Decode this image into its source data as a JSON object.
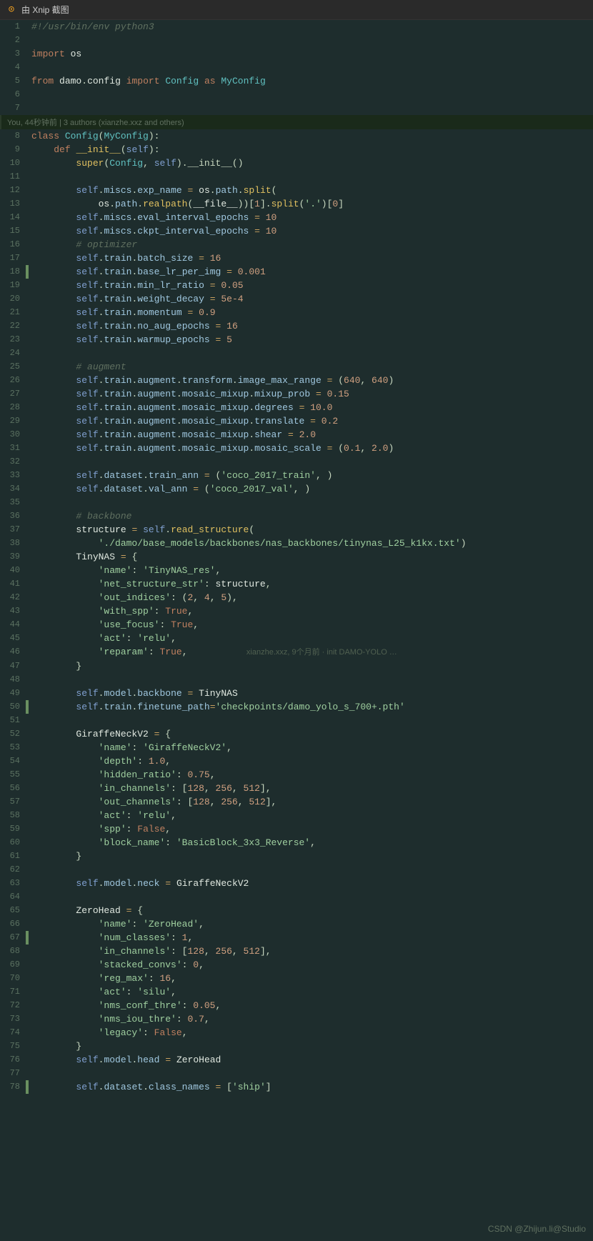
{
  "title": "由 Xnip 截图",
  "watermark": "CSDN @Zhijun.li@Studio",
  "git_blame": "You, 44秒钟前 | 3 authors (xianzhe.xxz and others)",
  "lines": [
    {
      "num": 1,
      "content": "#!/usr/bin/env python3",
      "indicator": false
    },
    {
      "num": 2,
      "content": "",
      "indicator": false
    },
    {
      "num": 3,
      "content": "import os",
      "indicator": false
    },
    {
      "num": 4,
      "content": "",
      "indicator": false
    },
    {
      "num": 5,
      "content": "from damo.config import Config as MyConfig",
      "indicator": false
    },
    {
      "num": 6,
      "content": "",
      "indicator": false
    },
    {
      "num": 7,
      "content": "",
      "indicator": false
    },
    {
      "num": 8,
      "content": "class Config(MyConfig):",
      "indicator": false
    },
    {
      "num": 9,
      "content": "    def __init__(self):",
      "indicator": false
    },
    {
      "num": 10,
      "content": "        super(Config, self).__init__()",
      "indicator": false
    },
    {
      "num": 11,
      "content": "",
      "indicator": false
    },
    {
      "num": 12,
      "content": "        self.miscs.exp_name = os.path.split(",
      "indicator": false
    },
    {
      "num": 13,
      "content": "            os.path.realpath(__file__))[1].split('.')[0]",
      "indicator": false
    },
    {
      "num": 14,
      "content": "        self.miscs.eval_interval_epochs = 10",
      "indicator": false
    },
    {
      "num": 15,
      "content": "        self.miscs.ckpt_interval_epochs = 10",
      "indicator": false
    },
    {
      "num": 16,
      "content": "        # optimizer",
      "indicator": false
    },
    {
      "num": 17,
      "content": "        self.train.batch_size = 16",
      "indicator": false
    },
    {
      "num": 18,
      "content": "        self.train.base_lr_per_img = 0.001",
      "indicator": true
    },
    {
      "num": 19,
      "content": "        self.train.min_lr_ratio = 0.05",
      "indicator": false
    },
    {
      "num": 20,
      "content": "        self.train.weight_decay = 5e-4",
      "indicator": false
    },
    {
      "num": 21,
      "content": "        self.train.momentum = 0.9",
      "indicator": false
    },
    {
      "num": 22,
      "content": "        self.train.no_aug_epochs = 16",
      "indicator": false
    },
    {
      "num": 23,
      "content": "        self.train.warmup_epochs = 5",
      "indicator": false
    },
    {
      "num": 24,
      "content": "",
      "indicator": false
    },
    {
      "num": 25,
      "content": "        # augment",
      "indicator": false
    },
    {
      "num": 26,
      "content": "        self.train.augment.transform.image_max_range = (640, 640)",
      "indicator": false
    },
    {
      "num": 27,
      "content": "        self.train.augment.mosaic_mixup.mixup_prob = 0.15",
      "indicator": false
    },
    {
      "num": 28,
      "content": "        self.train.augment.mosaic_mixup.degrees = 10.0",
      "indicator": false
    },
    {
      "num": 29,
      "content": "        self.train.augment.mosaic_mixup.translate = 0.2",
      "indicator": false
    },
    {
      "num": 30,
      "content": "        self.train.augment.mosaic_mixup.shear = 2.0",
      "indicator": false
    },
    {
      "num": 31,
      "content": "        self.train.augment.mosaic_mixup.mosaic_scale = (0.1, 2.0)",
      "indicator": false
    },
    {
      "num": 32,
      "content": "",
      "indicator": false
    },
    {
      "num": 33,
      "content": "        self.dataset.train_ann = ('coco_2017_train', )",
      "indicator": false
    },
    {
      "num": 34,
      "content": "        self.dataset.val_ann = ('coco_2017_val', )",
      "indicator": false
    },
    {
      "num": 35,
      "content": "",
      "indicator": false
    },
    {
      "num": 36,
      "content": "        # backbone",
      "indicator": false
    },
    {
      "num": 37,
      "content": "        structure = self.read_structure(",
      "indicator": false
    },
    {
      "num": 38,
      "content": "            './damo/base_models/backbones/nas_backbones/tinynas_L25_k1kx.txt')",
      "indicator": false
    },
    {
      "num": 39,
      "content": "        TinyNAS = {",
      "indicator": false
    },
    {
      "num": 40,
      "content": "            'name': 'TinyNAS_res',",
      "indicator": false
    },
    {
      "num": 41,
      "content": "            'net_structure_str': structure,",
      "indicator": false
    },
    {
      "num": 42,
      "content": "            'out_indices': (2, 4, 5),",
      "indicator": false
    },
    {
      "num": 43,
      "content": "            'with_spp': True,",
      "indicator": false
    },
    {
      "num": 44,
      "content": "            'use_focus': True,",
      "indicator": false
    },
    {
      "num": 45,
      "content": "            'act': 'relu',",
      "indicator": false
    },
    {
      "num": 46,
      "content": "            'reparam': True,",
      "indicator": false
    },
    {
      "num": 47,
      "content": "        }",
      "indicator": false
    },
    {
      "num": 48,
      "content": "",
      "indicator": false
    },
    {
      "num": 49,
      "content": "        self.model.backbone = TinyNAS",
      "indicator": false
    },
    {
      "num": 50,
      "content": "        self.train.finetune_path='checkpoints/damo_yolo_s_700+.pth'",
      "indicator": true
    },
    {
      "num": 51,
      "content": "",
      "indicator": false
    },
    {
      "num": 52,
      "content": "        GiraffeNeckV2 = {",
      "indicator": false
    },
    {
      "num": 53,
      "content": "            'name': 'GiraffeNeckV2',",
      "indicator": false
    },
    {
      "num": 54,
      "content": "            'depth': 1.0,",
      "indicator": false
    },
    {
      "num": 55,
      "content": "            'hidden_ratio': 0.75,",
      "indicator": false
    },
    {
      "num": 56,
      "content": "            'in_channels': [128, 256, 512],",
      "indicator": false
    },
    {
      "num": 57,
      "content": "            'out_channels': [128, 256, 512],",
      "indicator": false
    },
    {
      "num": 58,
      "content": "            'act': 'relu',",
      "indicator": false
    },
    {
      "num": 59,
      "content": "            'spp': False,",
      "indicator": false
    },
    {
      "num": 60,
      "content": "            'block_name': 'BasicBlock_3x3_Reverse',",
      "indicator": false
    },
    {
      "num": 61,
      "content": "        }",
      "indicator": false
    },
    {
      "num": 62,
      "content": "",
      "indicator": false
    },
    {
      "num": 63,
      "content": "        self.model.neck = GiraffeNeckV2",
      "indicator": false
    },
    {
      "num": 64,
      "content": "",
      "indicator": false
    },
    {
      "num": 65,
      "content": "        ZeroHead = {",
      "indicator": false
    },
    {
      "num": 66,
      "content": "            'name': 'ZeroHead',",
      "indicator": false
    },
    {
      "num": 67,
      "content": "            'num_classes': 1,",
      "indicator": false
    },
    {
      "num": 68,
      "content": "            'in_channels': [128, 256, 512],",
      "indicator": false
    },
    {
      "num": 69,
      "content": "            'stacked_convs': 0,",
      "indicator": false
    },
    {
      "num": 70,
      "content": "            'reg_max': 16,",
      "indicator": false
    },
    {
      "num": 71,
      "content": "            'act': 'silu',",
      "indicator": false
    },
    {
      "num": 72,
      "content": "            'nms_conf_thre': 0.05,",
      "indicator": false
    },
    {
      "num": 73,
      "content": "            'nms_iou_thre': 0.7,",
      "indicator": false
    },
    {
      "num": 74,
      "content": "            'legacy': False,",
      "indicator": false
    },
    {
      "num": 75,
      "content": "        }",
      "indicator": false
    },
    {
      "num": 76,
      "content": "        self.model.head = ZeroHead",
      "indicator": false
    },
    {
      "num": 77,
      "content": "",
      "indicator": false
    },
    {
      "num": 78,
      "content": "        self.dataset.class_names = ['ship']",
      "indicator": true
    }
  ]
}
